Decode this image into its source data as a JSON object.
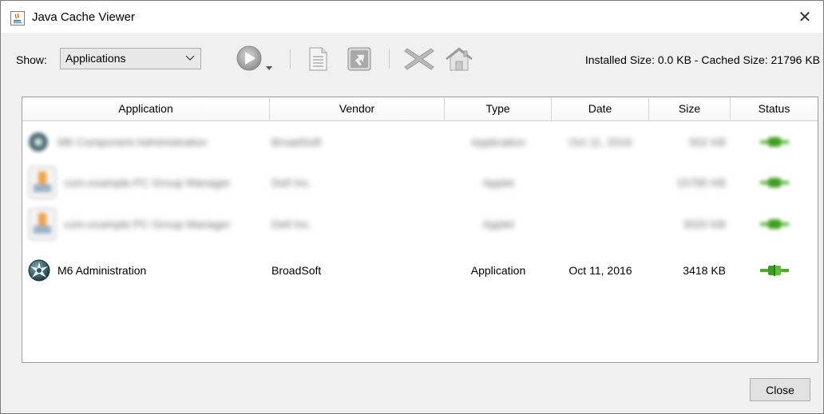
{
  "window": {
    "title": "Java Cache Viewer",
    "close_glyph": "✕"
  },
  "toolbar": {
    "show_label": "Show:",
    "show_selected": "Applications",
    "sizes_text": "Installed Size: 0.0 KB - Cached Size: 21796 KB",
    "icons": [
      "play-icon",
      "document-icon",
      "shortcut-icon",
      "delete-icon",
      "home-icon"
    ]
  },
  "table": {
    "columns": [
      "Application",
      "Vendor",
      "Type",
      "Date",
      "Size",
      "Status"
    ],
    "rows": [
      {
        "app": "M6 Component Administration",
        "vendor": "BroadSoft",
        "type": "Application",
        "date": "Oct 11, 2016",
        "size": "502 KB",
        "status": "installed",
        "blurred": true
      },
      {
        "app": "com.example.PC Group Manager",
        "vendor": "Dell Inc.",
        "type": "Applet",
        "date": "",
        "size": "15795 KB",
        "status": "installed",
        "blurred": true
      },
      {
        "app": "com.example.PC Group Manager",
        "vendor": "Dell Inc.",
        "type": "Applet",
        "date": "",
        "size": "3020 KB",
        "status": "installed",
        "blurred": true
      },
      {
        "app": "M6 Administration",
        "vendor": "BroadSoft",
        "type": "Application",
        "date": "Oct 11, 2016",
        "size": "3418 KB",
        "status": "installed",
        "blurred": false
      }
    ]
  },
  "footer": {
    "close_label": "Close"
  },
  "colors": {
    "status_green": "#4caf28",
    "icon_gray": "#8f8f8f",
    "accent": "#1f6fb5"
  }
}
